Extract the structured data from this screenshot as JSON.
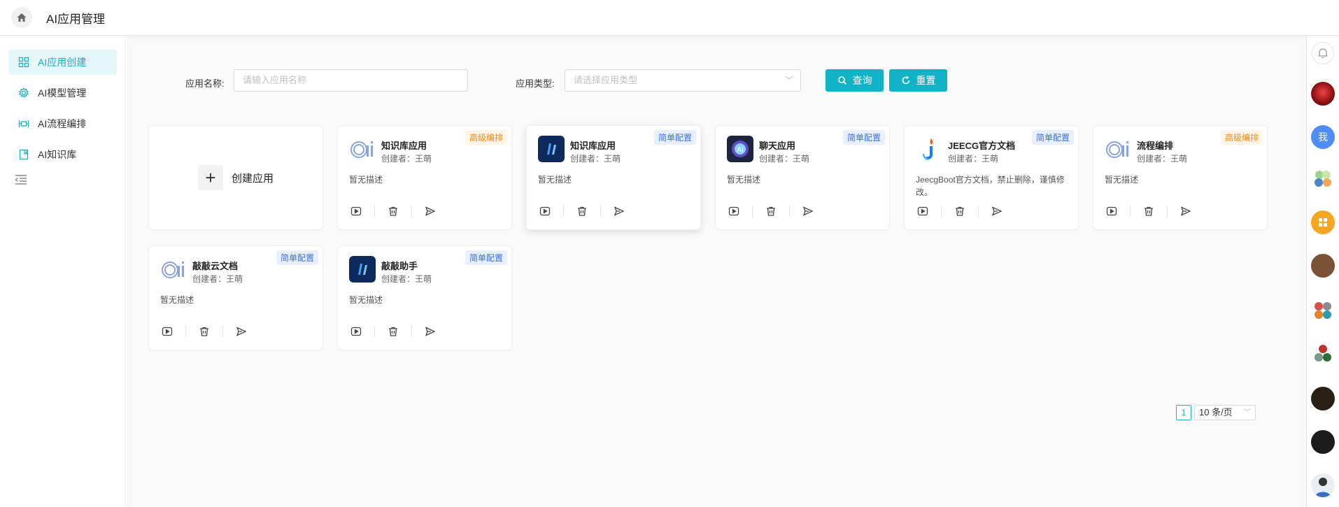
{
  "header": {
    "title": "AI应用管理"
  },
  "sidebar": {
    "items": [
      {
        "label": "AI应用创建",
        "icon": "grid-icon",
        "active": true
      },
      {
        "label": "AI模型管理",
        "icon": "gear-icon"
      },
      {
        "label": "AI流程编排",
        "icon": "flow-icon"
      },
      {
        "label": "AI知识库",
        "icon": "book-icon"
      }
    ]
  },
  "search": {
    "name_label": "应用名称:",
    "name_placeholder": "请输入应用名称",
    "type_label": "应用类型:",
    "type_placeholder": "请选择应用类型",
    "query_label": "查询",
    "reset_label": "重置"
  },
  "create_card": {
    "label": "创建应用"
  },
  "cards": [
    {
      "title": "知识库应用",
      "creator": "创建者：王萌",
      "desc": "暂无描述",
      "badge": "高级编排",
      "badge_type": "advanced",
      "logo": "ai-logo"
    },
    {
      "title": "知识库应用",
      "creator": "创建者：王萌",
      "desc": "暂无描述",
      "badge": "简单配置",
      "badge_type": "simple",
      "logo": "blue-app-logo"
    },
    {
      "title": "聊天应用",
      "creator": "创建者：王萌",
      "desc": "暂无描述",
      "badge": "简单配置",
      "badge_type": "simple",
      "logo": "chat-ai-logo"
    },
    {
      "title": "JEECG官方文档",
      "creator": "创建者：王萌",
      "desc": "JeecgBoot官方文档，禁止删除，谨慎修改。",
      "badge": "简单配置",
      "badge_type": "simple",
      "logo": "jeecg-logo"
    },
    {
      "title": "流程编排",
      "creator": "创建者：王萌",
      "desc": "暂无描述",
      "badge": "高级编排",
      "badge_type": "advanced",
      "logo": "ai-logo"
    },
    {
      "title": "敲敲云文档",
      "creator": "创建者：王萌",
      "desc": "暂无描述",
      "badge": "简单配置",
      "badge_type": "simple",
      "logo": "ai-logo"
    },
    {
      "title": "敲敲助手",
      "creator": "创建者：王萌",
      "desc": "暂无描述",
      "badge": "简单配置",
      "badge_type": "simple",
      "logo": "blue-app-logo"
    }
  ],
  "pagination": {
    "current_page": "1",
    "page_size": "10 条/页"
  },
  "rightbar": {
    "me_label": "我",
    "colors": {
      "accent": "#13b3c7",
      "me": "#4e8cf7",
      "apps": "#f5a623"
    }
  }
}
